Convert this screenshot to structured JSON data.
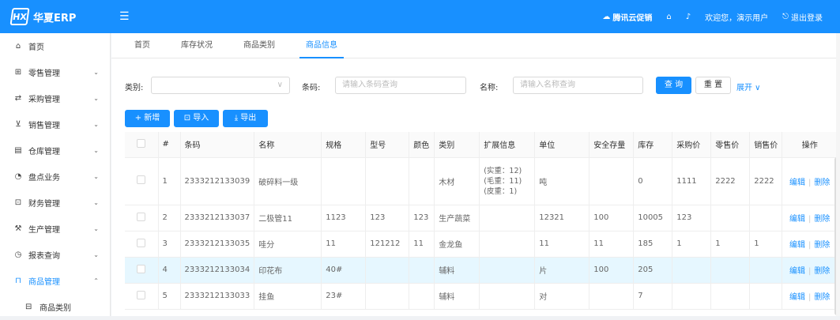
{
  "app": {
    "logo_mark": "HX",
    "title": "华夏ERP"
  },
  "header": {
    "promo": "腾讯云促销",
    "welcome": "欢迎您，演示用户",
    "logout": "退出登录"
  },
  "sidebar": {
    "items": [
      {
        "label": "首页",
        "icon": "home-icon",
        "glyph": "⌂",
        "chevron": ""
      },
      {
        "label": "零售管理",
        "icon": "shop-icon",
        "glyph": "⊞",
        "chevron": "⌄"
      },
      {
        "label": "采购管理",
        "icon": "exchange-icon",
        "glyph": "⇄",
        "chevron": "⌄"
      },
      {
        "label": "销售管理",
        "icon": "cart-icon",
        "glyph": "⊻",
        "chevron": "⌄"
      },
      {
        "label": "仓库管理",
        "icon": "warehouse-icon",
        "glyph": "▤",
        "chevron": "⌄"
      },
      {
        "label": "盘点业务",
        "icon": "dashboard-icon",
        "glyph": "◔",
        "chevron": "⌄"
      },
      {
        "label": "财务管理",
        "icon": "finance-icon",
        "glyph": "⊡",
        "chevron": "⌄"
      },
      {
        "label": "生产管理",
        "icon": "tool-icon",
        "glyph": "⚒",
        "chevron": "⌄"
      },
      {
        "label": "报表查询",
        "icon": "chart-icon",
        "glyph": "◷",
        "chevron": "⌄"
      },
      {
        "label": "商品管理",
        "icon": "shopping-bag-icon",
        "glyph": "⊓",
        "chevron": "⌃"
      }
    ],
    "sub": {
      "label": "商品类别",
      "glyph": "⊟"
    }
  },
  "tabs": [
    "首页",
    "库存状况",
    "商品类别",
    "商品信息"
  ],
  "filters": {
    "category_label": "类别:",
    "barcode_label": "条码:",
    "barcode_placeholder": "请输入条码查询",
    "name_label": "名称:",
    "name_placeholder": "请输入名称查询",
    "query": "查 询",
    "reset": "重 置",
    "expand": "展开 ∨"
  },
  "actions": {
    "add": "+ 新增",
    "import": "⊡ 导入",
    "export": "⤓ 导出"
  },
  "table": {
    "columns": [
      "",
      "#",
      "条码",
      "名称",
      "规格",
      "型号",
      "颜色",
      "类别",
      "扩展信息",
      "单位",
      "安全存量",
      "库存",
      "采购价",
      "零售价",
      "销售价",
      "操作"
    ],
    "edit": "编辑",
    "delete": "删除",
    "rows": [
      [
        "1",
        "2333212133039",
        "破碎料一级",
        "",
        "",
        "",
        "木材",
        "(实重：12)(毛重：11)(皮重：1)",
        "吨",
        "",
        "0",
        "1111",
        "2222",
        "2222"
      ],
      [
        "2",
        "2333212133037",
        "二极管11",
        "1123",
        "123",
        "123",
        "生产蔬菜",
        "",
        "12321",
        "100",
        "10005",
        "123",
        "",
        ""
      ],
      [
        "3",
        "2333212133035",
        "哇分",
        "11",
        "121212",
        "11",
        "金龙鱼",
        "",
        "11",
        "11",
        "185",
        "1",
        "1",
        "1"
      ],
      [
        "4",
        "2333212133034",
        "印花布",
        "40#",
        "",
        "",
        "辅料",
        "",
        "片",
        "100",
        "205",
        "",
        "",
        ""
      ],
      [
        "5",
        "2333212133033",
        "挂鱼",
        "23#",
        "",
        "",
        "辅料",
        "",
        "对",
        "",
        "7",
        "",
        "",
        ""
      ]
    ]
  }
}
